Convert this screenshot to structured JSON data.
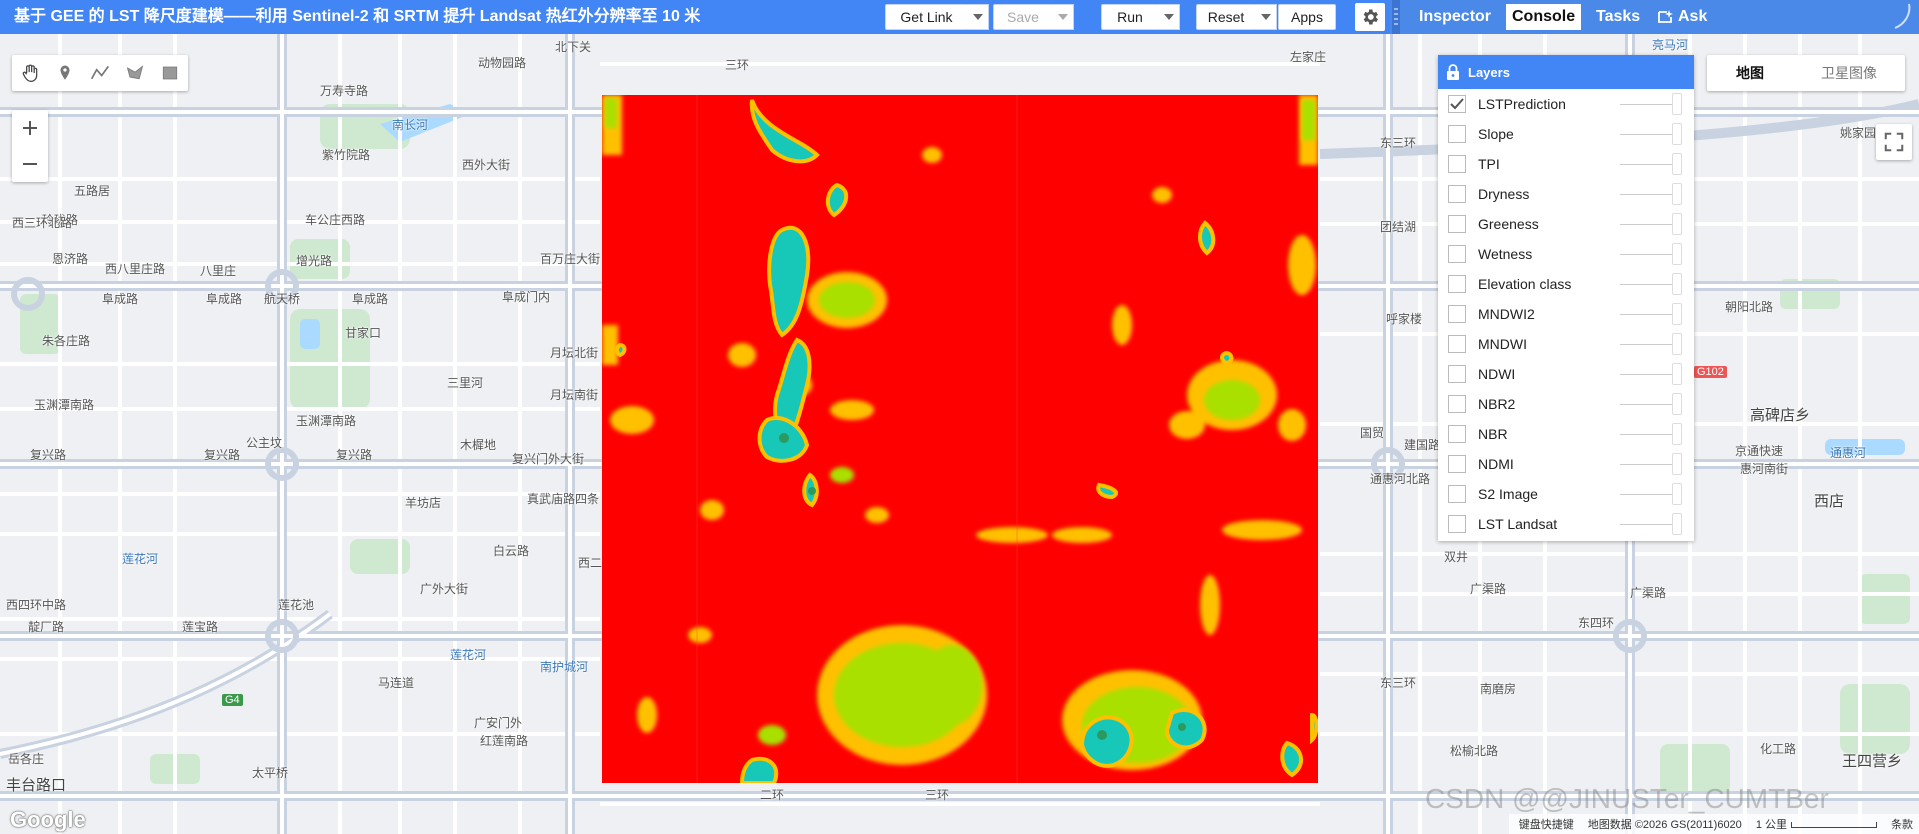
{
  "toolbar": {
    "title": "基于 GEE 的 LST 降尺度建模——利用 Sentinel-2 和 SRTM 提升 Landsat 热红外分辨率至 10 米",
    "get_link": "Get Link",
    "save": "Save",
    "run": "Run",
    "reset": "Reset",
    "apps": "Apps"
  },
  "panel_tabs": {
    "inspector": "Inspector",
    "console": "Console",
    "tasks": "Tasks",
    "ask": "Ask"
  },
  "map_type": {
    "map": "地图",
    "satellite": "卫星图像"
  },
  "layers": {
    "title": "Layers",
    "items": [
      {
        "name": "LSTPrediction",
        "checked": true
      },
      {
        "name": "Slope",
        "checked": false
      },
      {
        "name": "TPI",
        "checked": false
      },
      {
        "name": "Dryness",
        "checked": false
      },
      {
        "name": "Greeness",
        "checked": false
      },
      {
        "name": "Wetness",
        "checked": false
      },
      {
        "name": "Elevation class",
        "checked": false
      },
      {
        "name": "MNDWI2",
        "checked": false
      },
      {
        "name": "MNDWI",
        "checked": false
      },
      {
        "name": "NDWI",
        "checked": false
      },
      {
        "name": "NBR2",
        "checked": false
      },
      {
        "name": "NBR",
        "checked": false
      },
      {
        "name": "NDMI",
        "checked": false
      },
      {
        "name": "S2 Image",
        "checked": false
      },
      {
        "name": "LST Landsat",
        "checked": false
      }
    ]
  },
  "map_labels": {
    "l01": "北下关",
    "l02": "动物园路",
    "l03": "左家庄",
    "l04": "万寿寺路",
    "l05": "南长河",
    "l06": "紫竹院路",
    "l07": "西外大街",
    "l08": "五路居",
    "l09": "玲珑路",
    "l10": "车公庄西路",
    "l11": "恩济路",
    "l12": "西八里庄路",
    "l13": "八里庄",
    "l14": "增光路",
    "l15": "百万庄大街",
    "l16": "阜成路",
    "l17": "阜成路",
    "l18": "航天桥",
    "l19": "阜成路",
    "l20": "阜成门内",
    "l21": "朱各庄路",
    "l22": "甘家口",
    "l23": "三里河",
    "l24": "月坛北街",
    "l25": "月坛南街",
    "l26": "玉渊潭南路",
    "l27": "玉渊潭南路",
    "l28": "木樨地",
    "l29": "复兴路",
    "l30": "复兴路",
    "l31": "复兴路",
    "l32": "公主坟",
    "l33": "复兴门外大街",
    "l34": "羊坊店",
    "l35": "真武庙路四条",
    "l36": "白云路",
    "l37": "莲花河",
    "l38": "莲花池",
    "l39": "广外大街",
    "l40": "西四环中路",
    "l41": "靛厂路",
    "l42": "莲宝路",
    "l43": "马连道",
    "l44": "莲花河",
    "l45": "南护城河",
    "l46": "广安门外",
    "l47": "红莲南路",
    "l48": "丰台路口",
    "l49": "岳各庄",
    "l50": "太平桥",
    "l51": "亮马河",
    "l52": "姚家园",
    "l53": "朝阳北路",
    "l54": "高碑店乡",
    "l55": "京通快速",
    "l56": "惠河南街",
    "l57": "通惠河",
    "l58": "西店",
    "l59": "通惠河北路",
    "l60": "建国路",
    "l61": "国贸",
    "l62": "广渠路",
    "l63": "广渠路",
    "l64": "松榆北路",
    "l65": "南磨房",
    "l66": "化工路",
    "l67": "王四营乡",
    "l68": "双井",
    "l69": "团结湖",
    "l70": "呼家楼",
    "l71": "G102",
    "l72": "G4",
    "l73": "三环",
    "l74": "东三环",
    "l75": "西三环北路",
    "l76": "东四环",
    "l77": "西二环",
    "l78": "二环",
    "l79": "三环",
    "l80": "东三环"
  },
  "footer": {
    "google": "Google",
    "watermark": "CSDN @@JINUSTer_CUMTBer",
    "shortcuts": "键盘快捷键",
    "map_data": "地图数据 ©2026 GS(2011)6020",
    "scale": "1 公里",
    "terms": "条款"
  },
  "colors": {
    "toolbar_bg": "#4285f4",
    "lst_hot": "#ff0000",
    "lst_warm": "#ffc000",
    "lst_mild": "#a9e000",
    "lst_cool": "#17c8b8"
  }
}
